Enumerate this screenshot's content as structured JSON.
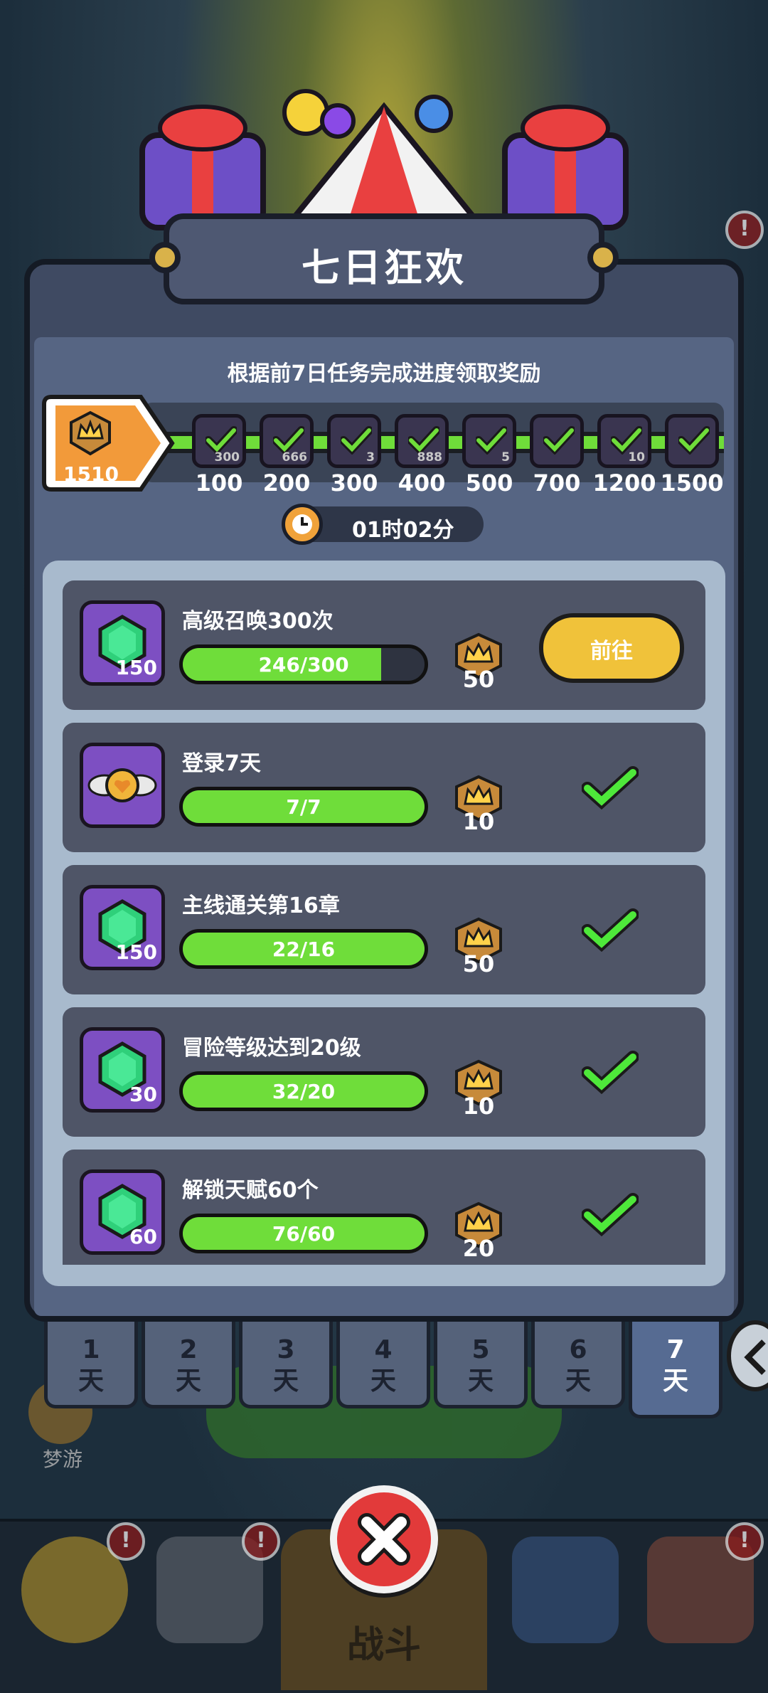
{
  "header": {
    "title": "七日狂欢"
  },
  "panel": {
    "subtitle": "根据前7日任务完成进度领取奖励"
  },
  "score": {
    "value": "1510"
  },
  "milestones": [
    {
      "label": "100",
      "count": "300",
      "done": true
    },
    {
      "label": "200",
      "count": "666",
      "done": true
    },
    {
      "label": "300",
      "count": "3",
      "done": true
    },
    {
      "label": "400",
      "count": "888",
      "done": true
    },
    {
      "label": "500",
      "count": "5",
      "done": true
    },
    {
      "label": "700",
      "count": "",
      "done": true
    },
    {
      "label": "1200",
      "count": "10",
      "done": true
    },
    {
      "label": "1500",
      "count": "",
      "done": true
    }
  ],
  "timer": {
    "text": "01时02分"
  },
  "tasks": [
    {
      "title": "高级召唤300次",
      "icon": "green-gem-icon",
      "icon_amount": "150",
      "progress_text": "246/300",
      "progress": 0.82,
      "reward": "50",
      "status": "go",
      "button_label": "前往"
    },
    {
      "title": "登录7天",
      "icon": "winged-heart-icon",
      "icon_amount": "",
      "progress_text": "7/7",
      "progress": 1.0,
      "reward": "10",
      "status": "done"
    },
    {
      "title": "主线通关第16章",
      "icon": "green-gem-icon",
      "icon_amount": "150",
      "progress_text": "22/16",
      "progress": 1.0,
      "reward": "50",
      "status": "done"
    },
    {
      "title": "冒险等级达到20级",
      "icon": "green-gem-icon",
      "icon_amount": "30",
      "progress_text": "32/20",
      "progress": 1.0,
      "reward": "10",
      "status": "done"
    },
    {
      "title": "解锁天赋60个",
      "icon": "green-gem-icon",
      "icon_amount": "60",
      "progress_text": "76/60",
      "progress": 1.0,
      "reward": "20",
      "status": "done"
    }
  ],
  "tabs": [
    {
      "num": "1",
      "unit": "天",
      "active": false
    },
    {
      "num": "2",
      "unit": "天",
      "active": false
    },
    {
      "num": "3",
      "unit": "天",
      "active": false
    },
    {
      "num": "4",
      "unit": "天",
      "active": false
    },
    {
      "num": "5",
      "unit": "天",
      "active": false
    },
    {
      "num": "6",
      "unit": "天",
      "active": false
    },
    {
      "num": "7",
      "unit": "天",
      "active": true
    }
  ],
  "background": {
    "sleep_label": "梦游",
    "bottom_nav_center_label": "战斗",
    "nav_badges": [
      "!",
      "!",
      "!",
      "!"
    ]
  },
  "colors": {
    "accent_green": "#6fdd3a",
    "button_yellow": "#f0c23a",
    "close_red": "#e23a3a",
    "panel": "#3f4a62"
  }
}
